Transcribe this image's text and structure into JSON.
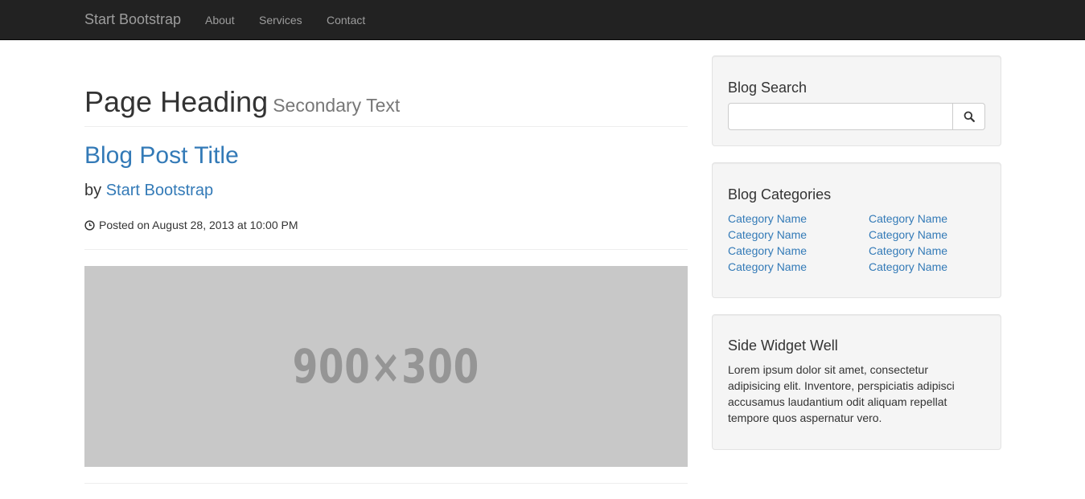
{
  "navbar": {
    "brand": "Start Bootstrap",
    "links": [
      {
        "label": "About"
      },
      {
        "label": "Services"
      },
      {
        "label": "Contact"
      }
    ]
  },
  "main": {
    "heading": "Page Heading",
    "subheading": "Secondary Text",
    "post": {
      "title": "Blog Post Title",
      "by_prefix": "by",
      "author": "Start Bootstrap",
      "posted": "Posted on August 28, 2013 at 10:00 PM",
      "image_placeholder": "900×300"
    }
  },
  "sidebar": {
    "search": {
      "title": "Blog Search",
      "value": "",
      "button_icon": "search-icon"
    },
    "categories": {
      "title": "Blog Categories",
      "left": [
        "Category Name",
        "Category Name",
        "Category Name",
        "Category Name"
      ],
      "right": [
        "Category Name",
        "Category Name",
        "Category Name",
        "Category Name"
      ]
    },
    "widget": {
      "title": "Side Widget Well",
      "text": "Lorem ipsum dolor sit amet, consectetur adipisicing elit. Inventore, perspiciatis adipisci accusamus laudantium odit aliquam repellat tempore quos aspernatur vero."
    }
  },
  "colors": {
    "navbar_bg": "#222222",
    "link": "#337ab7",
    "well_bg": "#f5f5f5",
    "placeholder_bg": "#c8c8c8"
  }
}
